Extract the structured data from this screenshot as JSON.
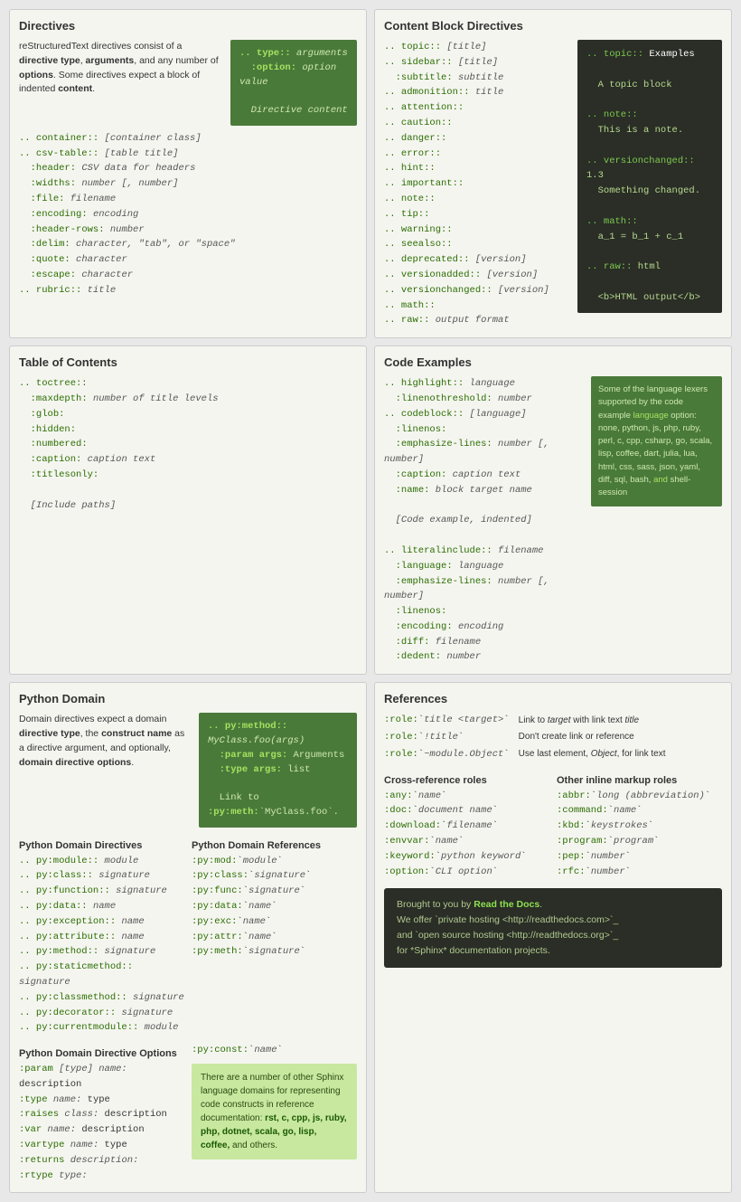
{
  "directives": {
    "title": "Directives",
    "description": "reStructuredText directives consist of a directive type, arguments, and any number of options. Some directives expect a block of indented content.",
    "syntax": {
      "line1": ".. type:: arguments",
      "line2": ":option: option value",
      "line3": "",
      "line4": "Directive content"
    },
    "items": [
      ".. container:: [container class]",
      ".. csv-table:: [table title]",
      "   :header: CSV data for headers",
      "   :widths: number [, number]",
      "   :file: filename",
      "   :encoding: encoding",
      "   :header-rows: number",
      "   :delim: character, \"tab\", or \"space\"",
      "   :quote: character",
      "   :escape: character",
      ".. rubric:: title"
    ]
  },
  "toc": {
    "title": "Table of Contents",
    "items": [
      ".. toctree::",
      "   :maxdepth: number of title levels",
      "   :glob:",
      "   :hidden:",
      "   :numbered:",
      "   :caption: caption text",
      "   :titlesonly:",
      "",
      "   [Include paths]"
    ]
  },
  "python_domain": {
    "title": "Python Domain",
    "description": "Domain directives expect a domain directive type, the construct name as a directive argument, and optionally, domain directive options.",
    "example": {
      "line1": ".. py:method:: MyClass.foo(args)",
      "line2": "   :param args: Arguments",
      "line3": "   :type args: list",
      "line4": "",
      "line5": "   Link to :py:meth:`MyClass.foo`."
    },
    "directives_title": "Python Domain Directives",
    "directives": [
      ".. py:module:: module",
      ".. py:class:: signature",
      ".. py:function:: signature",
      ".. py:data:: name",
      ".. py:exception:: name",
      ".. py:attribute:: name",
      ".. py:method:: signature",
      ".. py:staticmethod:: signature",
      ".. py:classmethod:: signature",
      ".. py:decorator:: signature",
      ".. py:currentmodule:: module"
    ],
    "references_title": "Python Domain References",
    "references": [
      ":py:mod:`module`",
      ":py:class:`signature`",
      ":py:func:`signature`",
      ":py:data:`name`",
      ":py:exc:`name`",
      ":py:attr:`name`",
      ":py:meth:`signature`"
    ],
    "options_title": "Python Domain Directive Options",
    "options": [
      ":param [type] name: description",
      ":type name: type",
      ":raises class: description",
      ":var name: description",
      ":vartype name: type",
      ":returns description:",
      ":rtype type:"
    ],
    "other_domains_const": ":py:const:`name`",
    "other_domains_text": "There are a number of other Sphinx language domains for representing code constructs in reference documentation: rst, c, cpp, js, ruby, php, dotnet, scala, go, lisp, coffee, and others."
  },
  "content_block": {
    "title": "Content Block Directives",
    "items": [
      ".. topic:: [title]",
      ".. sidebar:: [title]",
      "   :subtitle: subtitle",
      ".. admonition:: title",
      ".. attention::",
      ".. caution::",
      ".. danger::",
      ".. error::",
      ".. hint::",
      ".. important::",
      ".. note::",
      ".. tip::",
      ".. warning::",
      ".. seealso::",
      ".. deprecated:: [version]",
      ".. versionadded:: [version]",
      ".. versionchanged:: [version]",
      ".. math::",
      ".. raw:: output format"
    ],
    "example": {
      "line1": ".. topic:: Examples",
      "line2": "",
      "line3": "   A topic block",
      "line4": "",
      "line5": ".. note::",
      "line6": "   This is a note.",
      "line7": "",
      "line8": ".. versionchanged:: 1.3",
      "line9": "   Something changed.",
      "line10": "",
      "line11": ".. math::",
      "line12": "   a_1 = b_1 + c_1",
      "line13": "",
      "line14": ".. raw:: html",
      "line15": "",
      "line16": "   <b>HTML output</b>"
    }
  },
  "code_examples": {
    "title": "Code Examples",
    "items": [
      ".. highlight:: language",
      "   :linenothreshold: number",
      ".. codeblock:: [language]",
      "   :linenos:",
      "   :emphasize-lines: number [, number]",
      "   :caption: caption text",
      "   :name: block target name",
      "",
      "   [Code example, indented]",
      "",
      ".. literalinclude:: filename",
      "   :language: language",
      "   :emphasize-lines: number [, number]",
      "   :linenos:",
      "   :encoding: encoding",
      "   :diff: filename",
      "   :dedent: number"
    ],
    "side_title": "Some of the language lexers supported by the code example",
    "side_option": "language option:",
    "lexers": "none, python, js, php, ruby, perl, c, cpp, csharp, go, scala, lisp, coffee, dart, julia, lua, html, css, sass, json, yaml, diff, sql, bash, and shell-session"
  },
  "references": {
    "title": "References",
    "role_items": [
      {
        "role": ":role:`title <target>`",
        "desc": "Link to target with link text title"
      },
      {
        "role": ":role:`!title`",
        "desc": "Don't create link or reference"
      },
      {
        "role": ":role:`~module.Object`",
        "desc": "Use last element, Object, for link text"
      }
    ],
    "cross_title": "Cross-reference roles",
    "cross_items": [
      ":any:`name`",
      ":doc:`document name`",
      ":download:`filename`",
      ":envvar:`name`",
      ":keyword:`python keyword`",
      ":option:`CLI option`"
    ],
    "other_title": "Other inline markup roles",
    "other_items": [
      ":abbr:`long (abbreviation)`",
      ":command:`name`",
      ":kbd:`keystrokes`",
      ":program:`program`",
      ":pep:`number`",
      ":rfc:`number`"
    ]
  },
  "footer": {
    "line1": "Brought to you by **Read the Docs**.",
    "line2": "We offer `private hosting <http://readthedocs.com>`_",
    "line3": "and `open source hosting <http://readthedocs.org>`_",
    "line4": "for *Sphinx* documentation projects."
  }
}
